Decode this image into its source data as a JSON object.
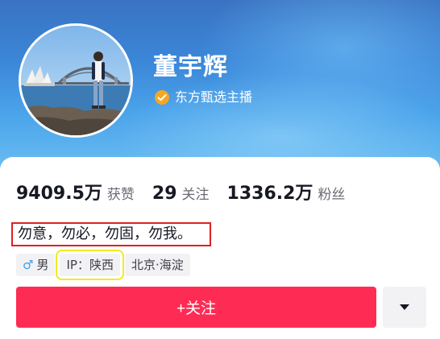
{
  "profile": {
    "name": "董宇辉",
    "verification": "东方甄选主播",
    "bio": "勿意，勿必，勿固，勿我。"
  },
  "stats": {
    "likes_value": "9409.5万",
    "likes_label": "获赞",
    "following_value": "29",
    "following_label": "关注",
    "followers_value": "1336.2万",
    "followers_label": "粉丝"
  },
  "tags": {
    "gender_icon": "♂",
    "gender": "男",
    "ip": "IP：陕西",
    "location": "北京·海淀"
  },
  "actions": {
    "follow_label": "+关注"
  },
  "icons": {
    "verify": "verified-badge-icon",
    "gender": "male-icon",
    "more": "dropdown-triangle-icon"
  },
  "colors": {
    "accent": "#fe2c55",
    "verify_badge": "#f5a623",
    "highlight_red": "#e02020",
    "highlight_yellow": "#f1ea22",
    "male": "#3aa0f0"
  }
}
